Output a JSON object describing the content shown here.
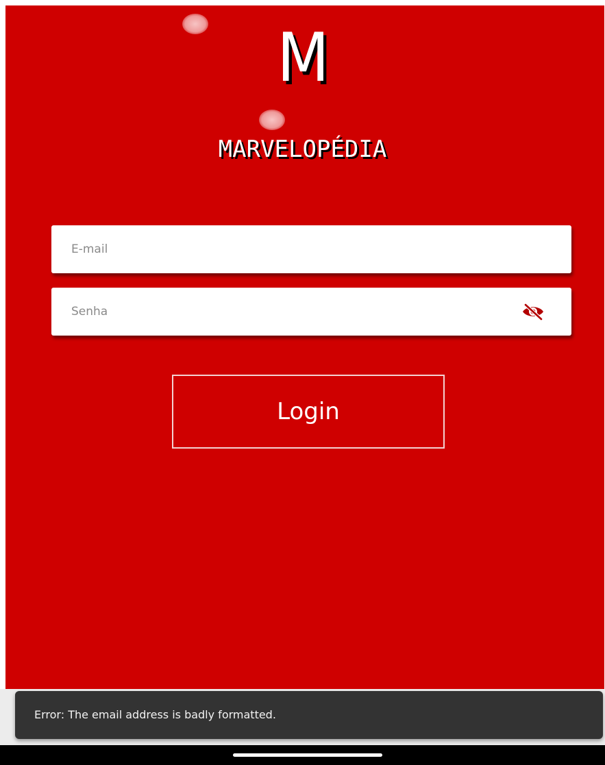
{
  "app": {
    "logo_letter": "M",
    "brand_name": "MARVELOPÉDIA"
  },
  "form": {
    "email": {
      "placeholder": "E-mail",
      "value": ""
    },
    "password": {
      "placeholder": "Senha",
      "value": "",
      "visibility_icon": "eye-off-icon"
    },
    "login_label": "Login"
  },
  "snackbar": {
    "message": "Error: The email address is badly formatted."
  },
  "colors": {
    "background": "#cf0000",
    "field_background": "#ffffff",
    "icon_accent": "#b30000",
    "snackbar_background": "#333333",
    "nav_bar": "#000000"
  }
}
